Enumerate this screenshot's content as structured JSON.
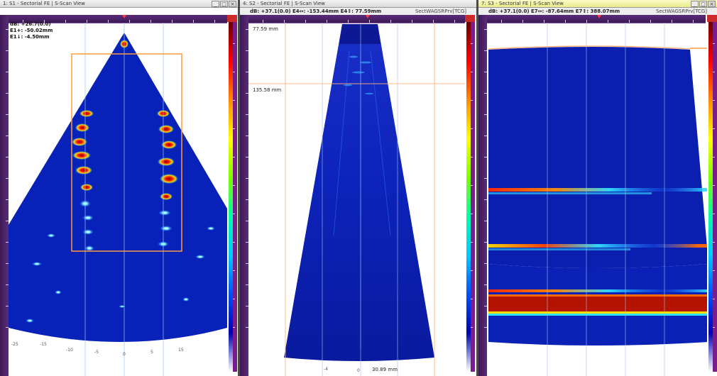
{
  "panels": [
    {
      "title": "1: S1 - Sectorial FE | S-Scan View",
      "readout": "",
      "tag": "",
      "info": [
        "dB: +26.7(0.0)",
        "E1+: -50.02mm",
        "E1↓: -4.50mm"
      ],
      "x_labels": [
        "-25",
        "-15",
        "-10",
        "-5",
        "0",
        "5",
        "15"
      ]
    },
    {
      "title": "4: S2 - Sectorial FE | S-Scan View",
      "readout": "dB: +37.1(0.0)   E4↔: -153.44mm  E4↕: 77.59mm",
      "tag": "SectWAGSRPrv[TCG]",
      "measurements": [
        "77.59 mm",
        "135.58 mm",
        "30.89 mm"
      ],
      "x_labels": [
        "-4",
        "0"
      ]
    },
    {
      "title": "7: S3 - Sectorial FE | S-Scan View",
      "readout": "dB: +37.1(0.0)   E7↔: -87.64mm  E7↕: 388.07mm",
      "tag": "SectWAGSRPrv[TCG]"
    }
  ],
  "icons": {
    "minimize": "minimize-icon",
    "maximize": "maximize-icon",
    "close": "close-icon"
  },
  "glyphs": {
    "minimize": "_",
    "maximize": "□",
    "close": "×"
  },
  "colors": {
    "background": "#0a1fb0",
    "deep": "#0010a0",
    "signal_red": "#b31400",
    "signal_yellow": "#ffdd00",
    "signal_cyan": "#30e0ff",
    "gate": "#ff9a3c"
  }
}
